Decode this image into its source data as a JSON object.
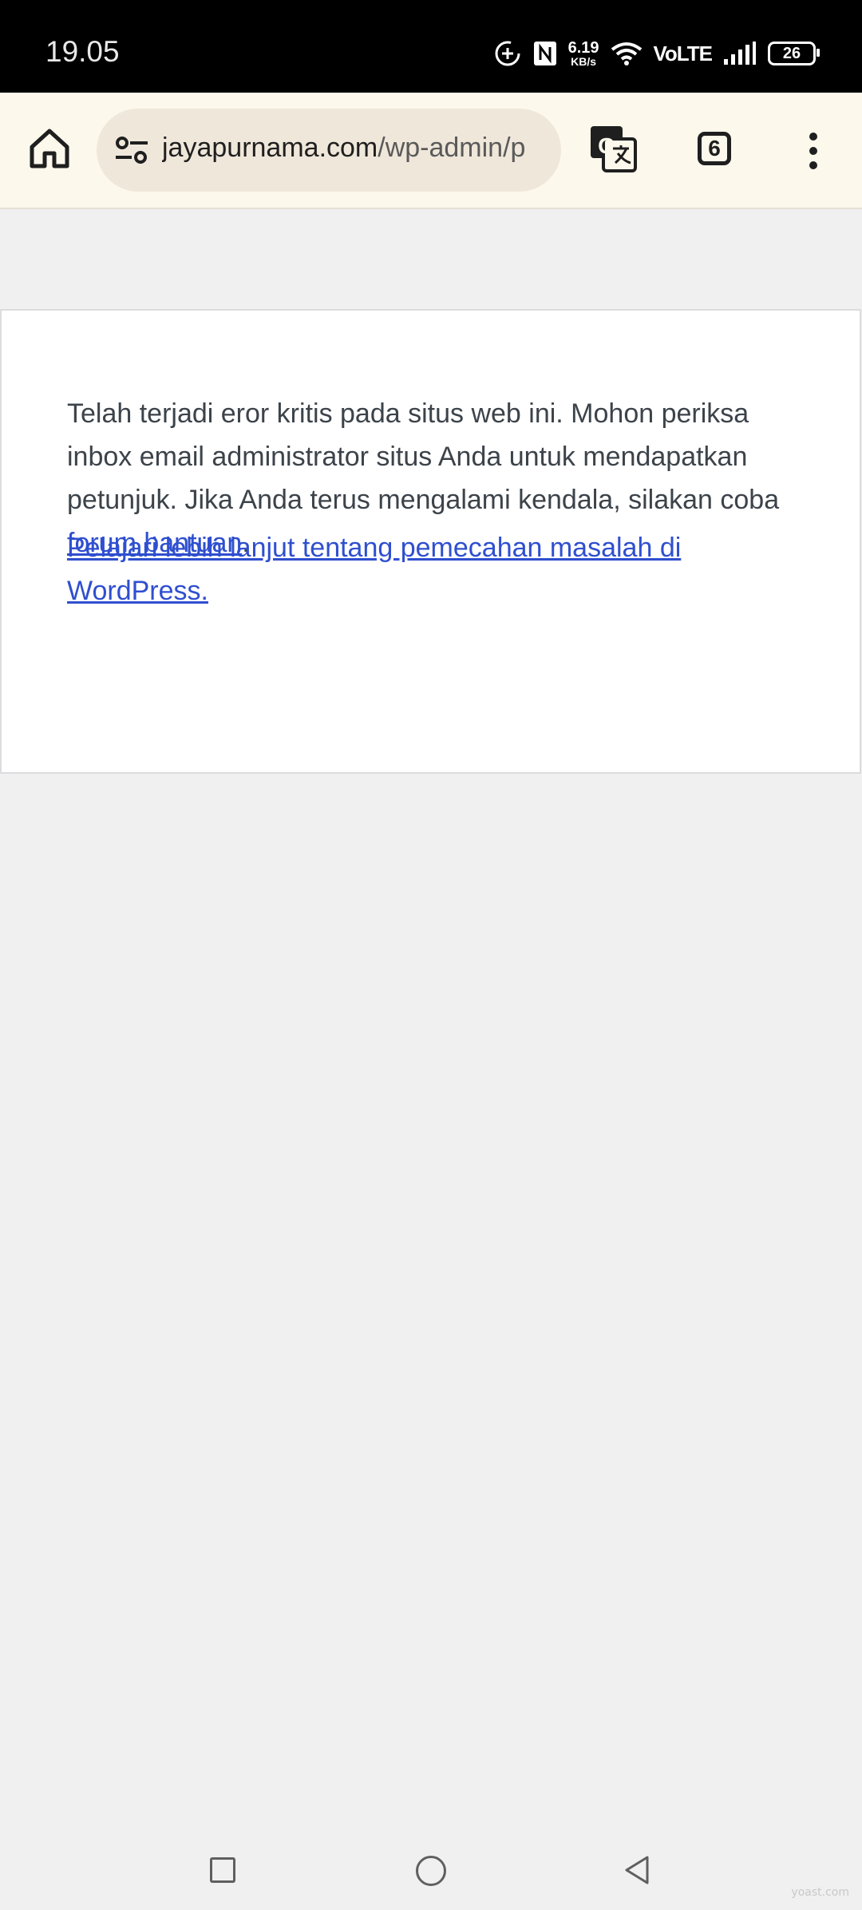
{
  "status_bar": {
    "time": "19.05",
    "net_speed_value": "6.19",
    "net_speed_unit": "KB/s",
    "network_label": "VoLTE",
    "battery_level": "26"
  },
  "browser": {
    "url_host": "jayapurnama.com",
    "url_path": "/wp-admin/p",
    "tab_count": "6",
    "icons": [
      "home-icon",
      "site-settings-icon",
      "translate-icon",
      "tab-switcher-icon",
      "more-vert-icon"
    ]
  },
  "error_page": {
    "message": "Telah terjadi eror kritis pada situs web ini. Mohon periksa inbox email administrator situs Anda untuk mendapatkan petunjuk. Jika Anda terus mengalami kendala, silakan coba ",
    "forum_link_label": "forum bantuan",
    "period": ".",
    "learn_more_label": "Pelajari lebih lanjut tentang pemecahan masalah di WordPress."
  },
  "nav_bar": {
    "icons": [
      "recent-apps-icon",
      "home-circle-icon",
      "back-triangle-icon"
    ]
  },
  "watermark": "yoast.com"
}
